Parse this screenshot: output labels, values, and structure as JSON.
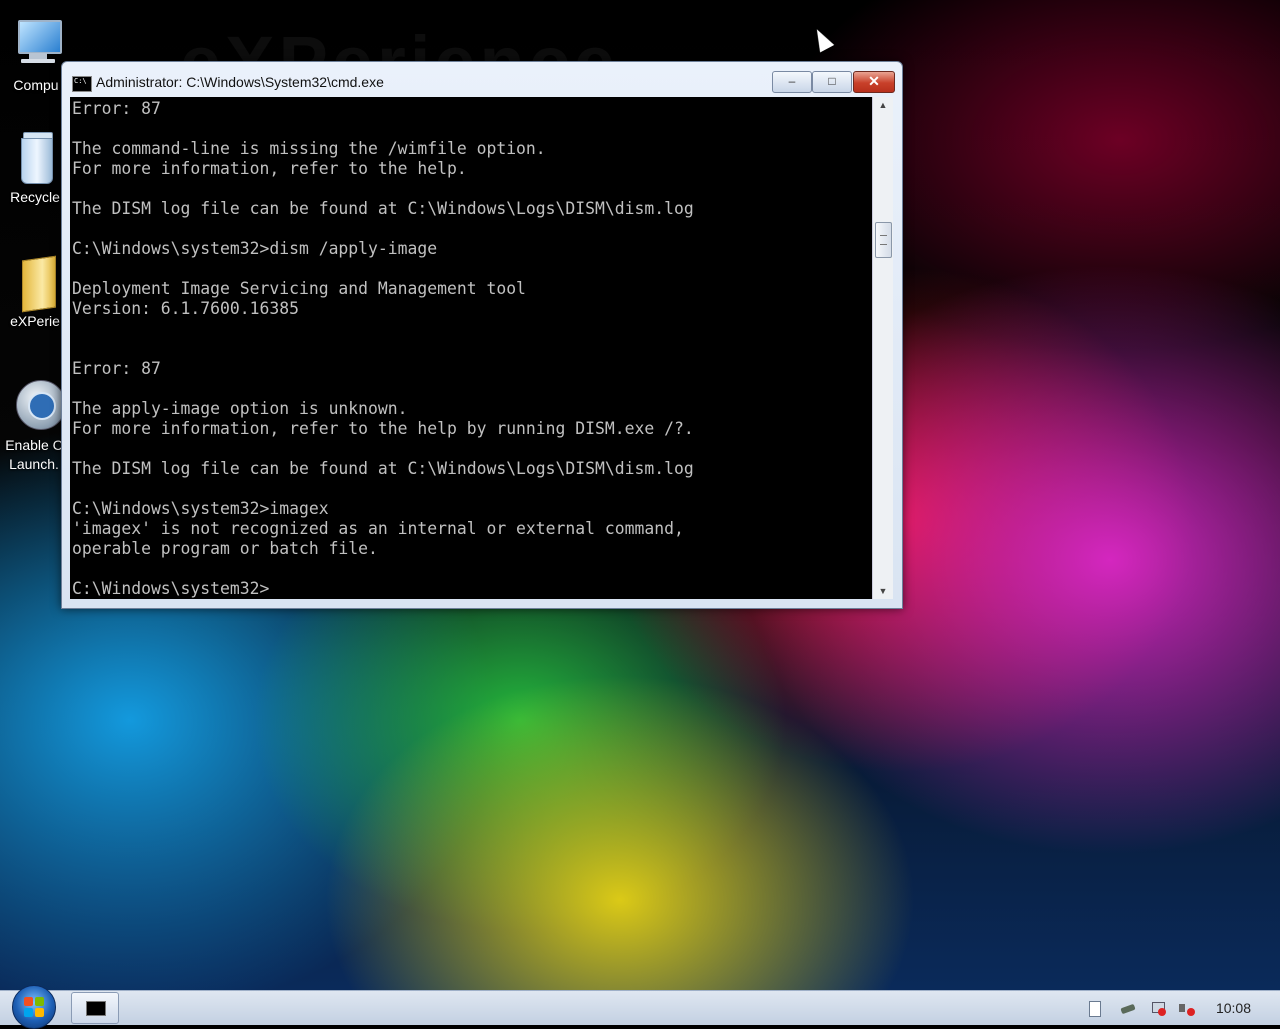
{
  "desktop": {
    "watermark": "eXPerience",
    "icons": [
      {
        "label": "Compu"
      },
      {
        "label": "Recycle"
      },
      {
        "label": "eXPerie"
      },
      {
        "label_line1": "Enable C",
        "label_line2": "Launch."
      }
    ]
  },
  "window": {
    "title": "Administrator: C:\\Windows\\System32\\cmd.exe",
    "minimize": "‒",
    "maximize": "□",
    "close": "✕",
    "console_text": "Error: 87\n\nThe command-line is missing the /wimfile option.\nFor more information, refer to the help.\n\nThe DISM log file can be found at C:\\Windows\\Logs\\DISM\\dism.log\n\nC:\\Windows\\system32>dism /apply-image\n\nDeployment Image Servicing and Management tool\nVersion: 6.1.7600.16385\n\n\nError: 87\n\nThe apply-image option is unknown.\nFor more information, refer to the help by running DISM.exe /?.\n\nThe DISM log file can be found at C:\\Windows\\Logs\\DISM\\dism.log\n\nC:\\Windows\\system32>imagex\n'imagex' is not recognized as an internal or external command,\noperable program or batch file.\n\nC:\\Windows\\system32>",
    "scroll_up": "▲",
    "scroll_down": "▼"
  },
  "taskbar": {
    "clock": "10:08",
    "tray_icons": [
      "action-center-icon",
      "network-icon",
      "network-disconnected-icon",
      "volume-muted-icon"
    ]
  },
  "colors": {
    "console_bg": "#000000",
    "console_fg": "#c0c0c0",
    "close_button": "#c8402a"
  }
}
